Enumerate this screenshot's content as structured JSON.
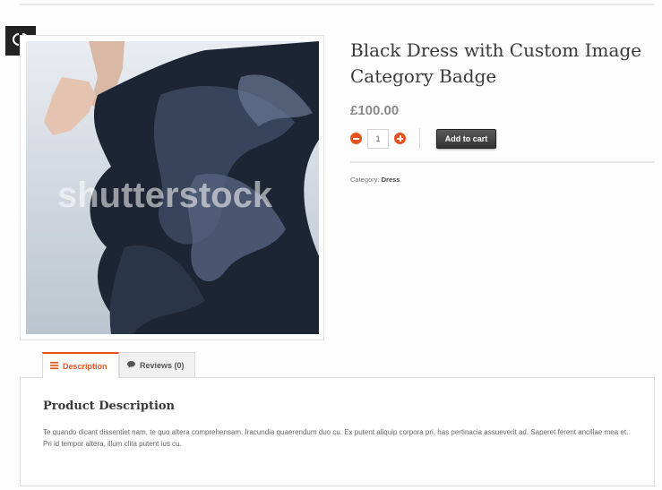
{
  "badge": {
    "icon": "chanel-logo-icon"
  },
  "product": {
    "title": "Black Dress with Custom Image Category Badge",
    "price": "£100.00",
    "quantity": "1",
    "add_to_cart_label": "Add to cart",
    "image_watermark": "shutterstock",
    "category_label": "Category:",
    "category_value": "Dress",
    "category_suffix": "."
  },
  "tabs": [
    {
      "label": "Description",
      "icon": "list-icon",
      "active": true
    },
    {
      "label": "Reviews (0)",
      "icon": "speech-bubble-icon",
      "active": false
    }
  ],
  "description": {
    "heading": "Product Description",
    "body": "Te quando dicant dissentiet nam, te quo altera comprehensam. Iracundia quaerendum duo cu. Ex putent aliquip corpora pri, has pertinacia assueverit ad. Saperet ferent ancillae mea et. Pri id tempor altera, illum clita putent ius cu."
  },
  "colors": {
    "accent": "#e8521c",
    "button": "#3a3a3a",
    "price": "#8a8a8a"
  }
}
